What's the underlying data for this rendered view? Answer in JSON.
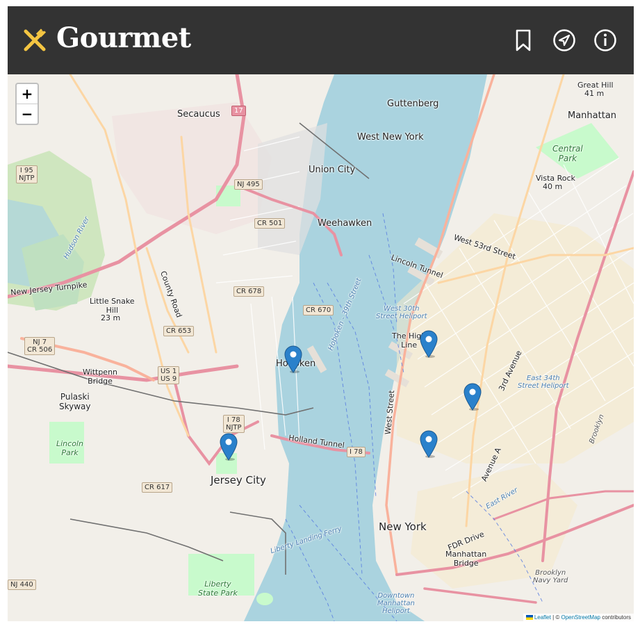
{
  "header": {
    "title": "Gourmet",
    "icons": [
      "fork-knife-icon",
      "bookmark-icon",
      "navigation-icon",
      "info-icon"
    ],
    "accent": "#f4c542",
    "background": "#333333"
  },
  "map": {
    "zoom_in": "+",
    "zoom_out": "−",
    "places": {
      "secaucus": "Secaucus",
      "guttenberg": "Guttenberg",
      "west_new_york": "West New York",
      "union_city": "Union City",
      "weehawken": "Weehawken",
      "hoboken": "Hoboken",
      "jersey_city": "Jersey City",
      "new_york": "New York",
      "manhattan": "Manhattan",
      "manhattan_bridge": "Manhattan\nBridge",
      "little_snake_hill": "Little Snake\nHill",
      "little_snake_hill_elev": "23 m",
      "great_hill": "Great Hill",
      "great_hill_elev": "41 m",
      "vista_rock": "Vista Rock",
      "vista_rock_elev": "40 m",
      "central_park": "Central\nPark",
      "liberty_state_park": "Liberty\nState Park",
      "lincoln_park": "Lincoln\nPark",
      "wittpenn_bridge": "Wittpenn\nBridge",
      "pulaski_skyway": "Pulaski\nSkyway",
      "high_line": "The High\nLine",
      "west_30th_heliport": "West 30th\nStreet Heliport",
      "east_34th_heliport": "East 34th\nStreet Heliport",
      "downtown_heliport": "Downtown\nManhattan\nHeliport",
      "brooklyn_navy_yard": "Brooklyn\nNavy Yard",
      "brooklyn": "Brooklyn",
      "holland_tunnel": "Holland Tunnel",
      "lincoln_tunnel": "Lincoln Tunnel",
      "new_jersey_turnpike": "New Jersey Turnpike",
      "hudson_river": "Hudson River",
      "east_river": "East River",
      "west_street": "West Street",
      "fdr_drive": "FDR Drive",
      "avenue_a": "Avenue A",
      "third_avenue": "3rd Avenue",
      "west_53rd": "West 53rd Street",
      "country_road": "County Road",
      "liberty_landing_ferry": "Liberty Landing Ferry",
      "hoboken_ferry": "Hoboken - 39th Street"
    },
    "shields": {
      "i95": "I 95\nNJTP",
      "nj495": "NJ 495",
      "cr501": "CR 501",
      "cr678": "CR 678",
      "cr670": "CR 670",
      "cr653": "CR 653",
      "nj7": "NJ 7\nCR 506",
      "us1": "US 1\nUS 9",
      "i78njtp": "I 78\nNJTP",
      "i78": "I 78",
      "cr617": "CR 617",
      "nj440": "NJ 440",
      "route17": "17"
    },
    "markers": [
      {
        "name": "marker-hoboken",
        "color": "#2a81cb"
      },
      {
        "name": "marker-jersey-city",
        "color": "#2a81cb"
      },
      {
        "name": "marker-high-line",
        "color": "#2a81cb"
      },
      {
        "name": "marker-midtown-east",
        "color": "#2a81cb"
      },
      {
        "name": "marker-gramercy",
        "color": "#2a81cb"
      }
    ],
    "attribution": {
      "leaflet": "Leaflet",
      "separator": " | © ",
      "osm": "OpenStreetMap",
      "suffix": " contributors"
    }
  }
}
